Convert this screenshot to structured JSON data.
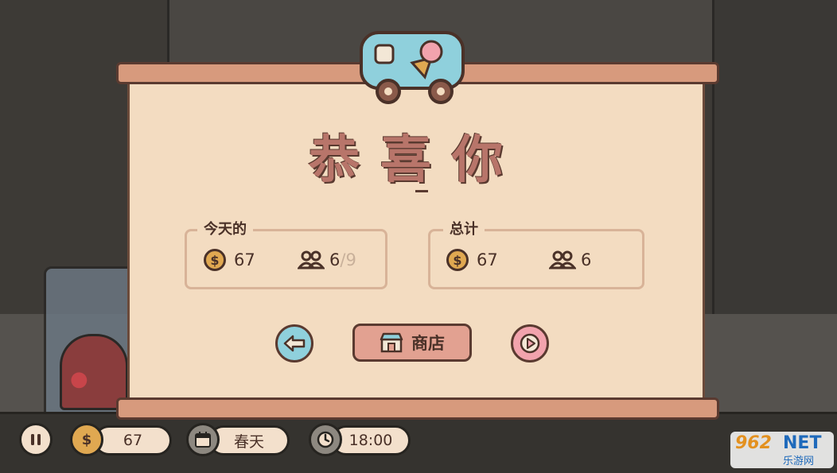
{
  "popup": {
    "title": "恭喜你",
    "subtitle": "—",
    "today": {
      "label": "今天的",
      "coins": "67",
      "customers": "6",
      "customers_max": "/9"
    },
    "total": {
      "label": "总计",
      "coins": "67",
      "customers": "6"
    },
    "buttons": {
      "back_icon": "arrow-left-icon",
      "shop_label": "商店",
      "next_icon": "play-icon"
    }
  },
  "hud": {
    "coins": "67",
    "season": "春天",
    "time": "18:00"
  },
  "watermark": {
    "number": "962",
    "net": "NET",
    "sub": "乐游网"
  },
  "colors": {
    "paper": "#f3dcc1",
    "rod": "#d79a7d",
    "title": "#b8756a",
    "back_button": "#8fd0dc",
    "next_button": "#f2a3ad",
    "shop_button": "#e2a191",
    "coin": "#e0a851"
  }
}
